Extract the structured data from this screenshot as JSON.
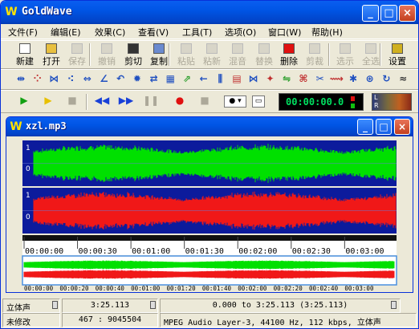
{
  "app": {
    "title": "GoldWave",
    "logo_letter": "W"
  },
  "menu": [
    "文件(F)",
    "编辑(E)",
    "效果(C)",
    "查看(V)",
    "工具(T)",
    "选项(O)",
    "窗口(W)",
    "帮助(H)"
  ],
  "toolbar1": [
    {
      "label": "新建",
      "enabled": true,
      "icon": "new-document-icon"
    },
    {
      "label": "打开",
      "enabled": true,
      "icon": "open-folder-icon"
    },
    {
      "label": "保存",
      "enabled": false,
      "icon": "save-disk-icon"
    },
    {
      "label": "撤销",
      "enabled": false,
      "icon": "undo-icon"
    },
    {
      "label": "剪切",
      "enabled": true,
      "icon": "scissors-icon"
    },
    {
      "label": "复制",
      "enabled": true,
      "icon": "copy-icon"
    },
    {
      "label": "粘贴",
      "enabled": false,
      "icon": "paste-icon"
    },
    {
      "label": "粘新",
      "enabled": false,
      "icon": "paste-new-icon"
    },
    {
      "label": "混音",
      "enabled": false,
      "icon": "mix-icon"
    },
    {
      "label": "替换",
      "enabled": false,
      "icon": "replace-icon"
    },
    {
      "label": "删除",
      "enabled": true,
      "icon": "delete-icon"
    },
    {
      "label": "剪裁",
      "enabled": false,
      "icon": "trim-icon"
    },
    {
      "label": "选示",
      "enabled": false,
      "icon": "show-selection-icon"
    },
    {
      "label": "全选",
      "enabled": false,
      "icon": "select-all-icon"
    },
    {
      "label": "设置",
      "enabled": true,
      "icon": "settings-icon"
    }
  ],
  "toolbar2_icons": [
    "effect-icon-1",
    "effect-icon-2",
    "effect-icon-3",
    "effect-icon-4",
    "effect-icon-5",
    "effect-icon-6",
    "effect-icon-7",
    "effect-icon-8",
    "effect-icon-9",
    "effect-icon-10",
    "effect-icon-11",
    "effect-icon-12",
    "effect-icon-13",
    "effect-icon-14",
    "effect-icon-15",
    "effect-icon-16",
    "effect-icon-17",
    "effect-icon-18",
    "effect-icon-19",
    "effect-icon-20",
    "effect-icon-21",
    "effect-icon-22",
    "effect-icon-23",
    "effect-icon-24"
  ],
  "transport": {
    "time": "00:00:00.0",
    "meter_label_l": "L",
    "meter_label_r": "R"
  },
  "document": {
    "title": "xzl.mp3",
    "channel_marks": [
      "1",
      "0",
      "1",
      "0"
    ]
  },
  "timeline": {
    "ticks": [
      "00:00:00",
      "00:00:30",
      "00:01:00",
      "00:01:30",
      "00:02:00",
      "00:02:30",
      "00:03:00"
    ],
    "overview_ticks": [
      "00:00:00",
      "00:00:20",
      "00:00:40",
      "00:01:00",
      "00:01:20",
      "00:01:40",
      "00:02:00",
      "00:02:20",
      "00:02:40",
      "00:03:00"
    ],
    "duration_seconds": 205.113
  },
  "status": {
    "channels": "立体声",
    "length": "3:25.113",
    "selection": "0.000 to 3:25.113 (3:25.113)",
    "modified": "未修改",
    "position": "467 : 9045504",
    "format": "MPEG Audio Layer-3, 44100 Hz, 112 kbps, 立体声"
  },
  "colors": {
    "left_channel": "#00E000",
    "right_channel": "#F01818",
    "wave_bg": "#0C1B9C",
    "lcd": "#00E060"
  }
}
